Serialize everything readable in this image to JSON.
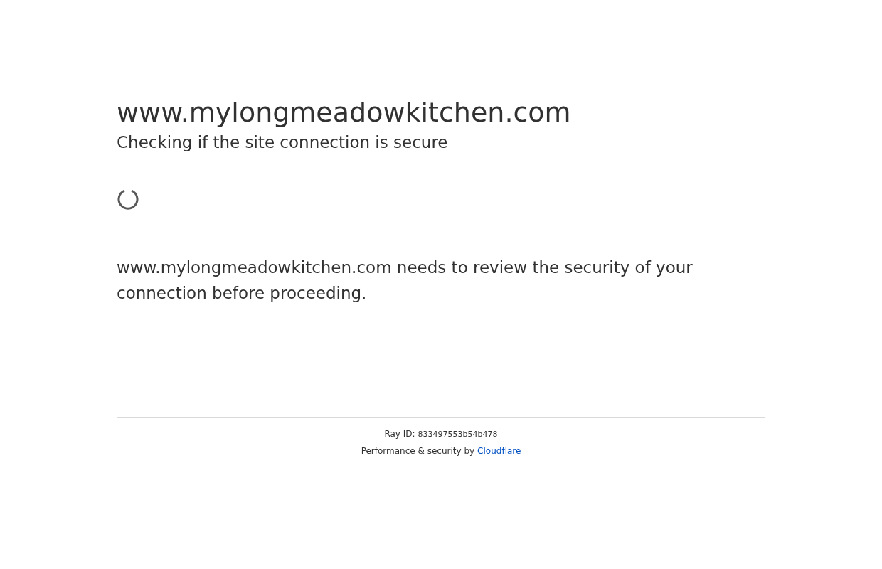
{
  "heading": "www.mylongmeadowkitchen.com",
  "subheading": "Checking if the site connection is secure",
  "message": "www.mylongmeadowkitchen.com needs to review the security of your connection before proceeding.",
  "footer": {
    "ray_label": "Ray ID:",
    "ray_id": "833497553b54b478",
    "performance_text": "Performance & security by",
    "link": "Cloudflare"
  }
}
